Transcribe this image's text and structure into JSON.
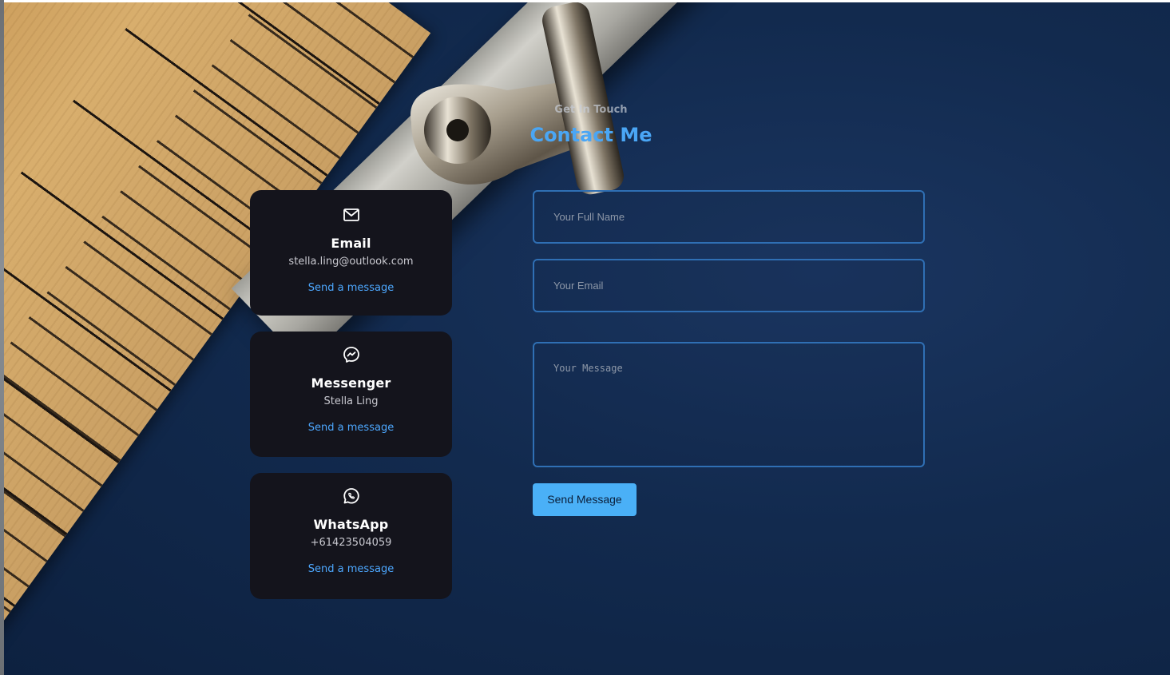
{
  "header": {
    "subtitle": "Get In Touch",
    "title": "Contact Me"
  },
  "contact_cards": [
    {
      "icon": "mail-icon",
      "title": "Email",
      "value": "stella.ling@outlook.com",
      "link": "Send a message"
    },
    {
      "icon": "messenger-icon",
      "title": "Messenger",
      "value": "Stella Ling",
      "link": "Send a message"
    },
    {
      "icon": "whatsapp-icon",
      "title": "WhatsApp",
      "value": "+61423504059",
      "link": "Send a message"
    }
  ],
  "form": {
    "name_placeholder": "Your Full Name",
    "email_placeholder": "Your Email",
    "message_placeholder": "Your Message",
    "submit_label": "Send Message"
  },
  "colors": {
    "accent": "#4aa6f5",
    "card_bg": "#14141c",
    "field_border": "#2f6fb4",
    "button_bg": "#4ab0f7"
  }
}
